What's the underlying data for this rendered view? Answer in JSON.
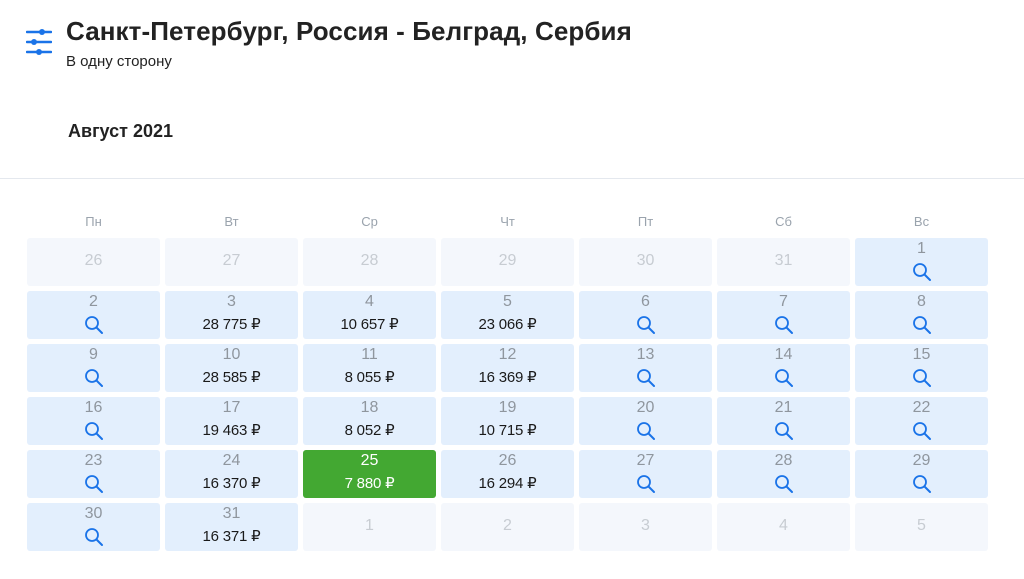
{
  "header": {
    "title": "Санкт-Петербург, Россия - Белград, Сербия",
    "trip_type": "В одну сторону",
    "filter_icon": "sliders-icon"
  },
  "calendar": {
    "month": "Август 2021",
    "weekdays": [
      "Пн",
      "Вт",
      "Ср",
      "Чт",
      "Пт",
      "Сб",
      "Вс"
    ],
    "colors": {
      "active": "#e3effd",
      "outside": "#f4f7fc",
      "selected": "#43a832",
      "icon": "#1a73e8"
    },
    "weeks": [
      [
        {
          "day": "26",
          "state": "outside"
        },
        {
          "day": "27",
          "state": "outside"
        },
        {
          "day": "28",
          "state": "outside"
        },
        {
          "day": "29",
          "state": "outside"
        },
        {
          "day": "30",
          "state": "outside"
        },
        {
          "day": "31",
          "state": "outside"
        },
        {
          "day": "1",
          "state": "search"
        }
      ],
      [
        {
          "day": "2",
          "state": "search"
        },
        {
          "day": "3",
          "state": "price",
          "price": "28 775 ₽"
        },
        {
          "day": "4",
          "state": "price",
          "price": "10 657 ₽"
        },
        {
          "day": "5",
          "state": "price",
          "price": "23 066 ₽"
        },
        {
          "day": "6",
          "state": "search"
        },
        {
          "day": "7",
          "state": "search"
        },
        {
          "day": "8",
          "state": "search"
        }
      ],
      [
        {
          "day": "9",
          "state": "search"
        },
        {
          "day": "10",
          "state": "price",
          "price": "28 585 ₽"
        },
        {
          "day": "11",
          "state": "price",
          "price": "8 055 ₽"
        },
        {
          "day": "12",
          "state": "price",
          "price": "16 369 ₽"
        },
        {
          "day": "13",
          "state": "search"
        },
        {
          "day": "14",
          "state": "search"
        },
        {
          "day": "15",
          "state": "search"
        }
      ],
      [
        {
          "day": "16",
          "state": "search"
        },
        {
          "day": "17",
          "state": "price",
          "price": "19 463 ₽"
        },
        {
          "day": "18",
          "state": "price",
          "price": "8 052 ₽"
        },
        {
          "day": "19",
          "state": "price",
          "price": "10 715 ₽"
        },
        {
          "day": "20",
          "state": "search"
        },
        {
          "day": "21",
          "state": "search"
        },
        {
          "day": "22",
          "state": "search"
        }
      ],
      [
        {
          "day": "23",
          "state": "search"
        },
        {
          "day": "24",
          "state": "price",
          "price": "16 370 ₽"
        },
        {
          "day": "25",
          "state": "selected",
          "price": "7 880 ₽"
        },
        {
          "day": "26",
          "state": "price",
          "price": "16 294 ₽"
        },
        {
          "day": "27",
          "state": "search"
        },
        {
          "day": "28",
          "state": "search"
        },
        {
          "day": "29",
          "state": "search"
        }
      ],
      [
        {
          "day": "30",
          "state": "search"
        },
        {
          "day": "31",
          "state": "price",
          "price": "16 371 ₽"
        },
        {
          "day": "1",
          "state": "outside"
        },
        {
          "day": "2",
          "state": "outside"
        },
        {
          "day": "3",
          "state": "outside"
        },
        {
          "day": "4",
          "state": "outside"
        },
        {
          "day": "5",
          "state": "outside"
        }
      ]
    ]
  }
}
